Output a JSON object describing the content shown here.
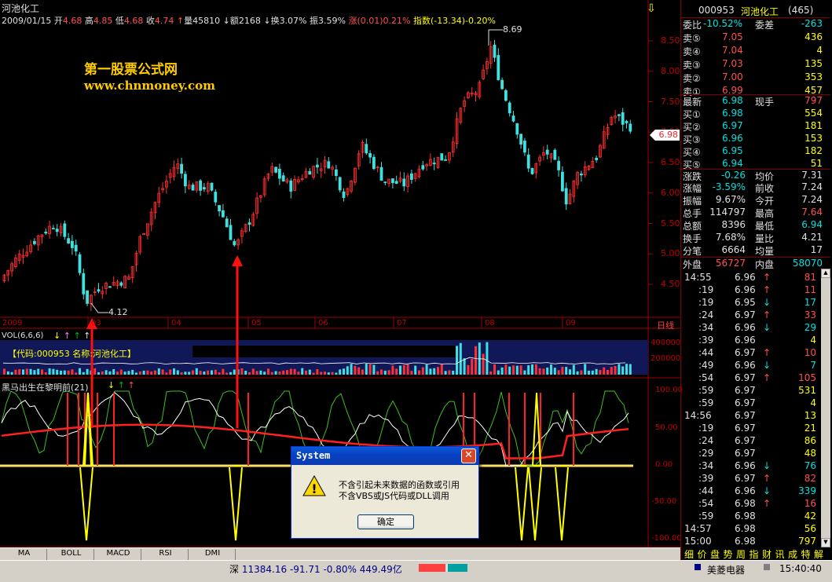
{
  "stock": {
    "name": "河池化工",
    "date": "2009/01/15",
    "open_label": "开",
    "open": "4.68",
    "high_label": "高",
    "high": "4.85",
    "low_label": "低",
    "low": "4.68",
    "close_label": "收",
    "close": "4.74",
    "vol_label": "量",
    "vol": "45810",
    "amt_label": "额",
    "amt": "2168",
    "turnover_label": "换",
    "turnover": "3.07%",
    "amp_label": "振",
    "amp": "3.59%",
    "chg_label": "涨",
    "chg": "(0.01)",
    "chg_pct": "0.21%",
    "index_label": "指数",
    "index_val": "(-13.34)",
    "index_pct": "-0.20%"
  },
  "watermark": {
    "line1": "第一股票公式网",
    "line2": "www.chnmoney.com"
  },
  "price_axis": [
    "8.50",
    "8.00",
    "7.50",
    "7.00",
    "6.50",
    "6.00",
    "5.50",
    "5.00",
    "4.50"
  ],
  "current_price_tag": "6.98",
  "annotations": {
    "high": "8.69",
    "low": "4.12"
  },
  "time_axis": {
    "year": "2009",
    "months": [
      "03",
      "04",
      "05",
      "06",
      "07",
      "08",
      "09"
    ],
    "period": "日线"
  },
  "vol_panel": {
    "title": "VOL(6,6,6)",
    "info": "【代码:000953 名称:河池化工】",
    "axis": [
      "400000",
      "200000"
    ]
  },
  "ind_panel": {
    "title": "黑马出生在黎明前(21)",
    "axis": [
      "100.00",
      "50.00",
      "0.00",
      "-50.00",
      "-100.00"
    ]
  },
  "tabs": [
    "MA",
    "BOLL",
    "MACD",
    "RSI",
    "DMI"
  ],
  "quote": {
    "header": {
      "code": "000953",
      "name": "河池化工",
      "num": "(465)"
    },
    "ratio": {
      "label1": "委比",
      "v1": "-10.52%",
      "label2": "委差",
      "v2": "-263"
    },
    "sells": [
      {
        "l": "卖⑤",
        "p": "7.05",
        "v": "436"
      },
      {
        "l": "卖④",
        "p": "7.04",
        "v": "4"
      },
      {
        "l": "卖③",
        "p": "7.03",
        "v": "135"
      },
      {
        "l": "卖②",
        "p": "7.00",
        "v": "353"
      },
      {
        "l": "卖①",
        "p": "6.99",
        "v": "457"
      }
    ],
    "latest": {
      "l": "最新",
      "p": "6.98",
      "l2": "现手",
      "v": "797"
    },
    "buys": [
      {
        "l": "买①",
        "p": "6.98",
        "v": "554"
      },
      {
        "l": "买②",
        "p": "6.97",
        "v": "181"
      },
      {
        "l": "买③",
        "p": "6.96",
        "v": "153"
      },
      {
        "l": "买④",
        "p": "6.95",
        "v": "182"
      },
      {
        "l": "买⑤",
        "p": "6.94",
        "v": "51"
      }
    ],
    "stats": [
      {
        "l1": "涨跌",
        "v1": "-0.26",
        "l2": "均价",
        "v2": "7.31"
      },
      {
        "l1": "涨幅",
        "v1": "-3.59%",
        "l2": "前收",
        "v2": "7.24"
      },
      {
        "l1": "振幅",
        "v1": "9.67%",
        "l2": "今开",
        "v2": "7.24"
      },
      {
        "l1": "总手",
        "v1": "114797",
        "l2": "最高",
        "v2": "7.64"
      },
      {
        "l1": "总额",
        "v1": "8396",
        "l2": "最低",
        "v2": "6.94"
      },
      {
        "l1": "换手",
        "v1": "7.68%",
        "l2": "量比",
        "v2": "4.21"
      },
      {
        "l1": "分笔",
        "v1": "6664",
        "l2": "均量",
        "v2": "17"
      }
    ],
    "outer": {
      "l1": "外盘",
      "v1": "56727",
      "l2": "内盘",
      "v2": "58070"
    }
  },
  "ticks": [
    {
      "t": "14:55",
      "p": "6.96",
      "v": "81",
      "d": "up"
    },
    {
      "t": ":19",
      "p": "6.96",
      "v": "11",
      "d": "up"
    },
    {
      "t": ":19",
      "p": "6.95",
      "v": "17",
      "d": "dn"
    },
    {
      "t": ":24",
      "p": "6.97",
      "v": "33",
      "d": "up"
    },
    {
      "t": ":34",
      "p": "6.96",
      "v": "29",
      "d": "dn"
    },
    {
      "t": ":39",
      "p": "6.96",
      "v": "4",
      "d": ""
    },
    {
      "t": ":44",
      "p": "6.97",
      "v": "10",
      "d": "up"
    },
    {
      "t": ":49",
      "p": "6.96",
      "v": "7",
      "d": "dn"
    },
    {
      "t": ":54",
      "p": "6.97",
      "v": "105",
      "d": "up"
    },
    {
      "t": ":59",
      "p": "6.97",
      "v": "531",
      "d": ""
    },
    {
      "t": ":59",
      "p": "6.97",
      "v": "4",
      "d": ""
    },
    {
      "t": "14:56",
      "p": "6.97",
      "v": "13",
      "d": ""
    },
    {
      "t": ":19",
      "p": "6.97",
      "v": "21",
      "d": ""
    },
    {
      "t": ":24",
      "p": "6.97",
      "v": "86",
      "d": ""
    },
    {
      "t": ":29",
      "p": "6.97",
      "v": "48",
      "d": ""
    },
    {
      "t": ":34",
      "p": "6.96",
      "v": "76",
      "d": "dn"
    },
    {
      "t": ":39",
      "p": "6.97",
      "v": "82",
      "d": "up"
    },
    {
      "t": ":44",
      "p": "6.96",
      "v": "339",
      "d": "dn"
    },
    {
      "t": ":54",
      "p": "6.98",
      "v": "16",
      "d": "up"
    },
    {
      "t": ":59",
      "p": "6.98",
      "v": "42",
      "d": ""
    },
    {
      "t": "14:57",
      "p": "6.98",
      "v": "56",
      "d": ""
    },
    {
      "t": "15:00",
      "p": "6.98",
      "v": "797",
      "d": ""
    }
  ],
  "side_tabs": [
    "细",
    "价",
    "盘",
    "势",
    "周",
    "指",
    "财",
    "讯",
    "成",
    "特",
    "解"
  ],
  "status": {
    "index_name": "深",
    "index_val": "11384.16",
    "index_chg": "-91.71",
    "index_pct": "-0.80%",
    "amount": "449.49亿",
    "ticker": "美菱电器",
    "clock": "15:40:40"
  },
  "dialog": {
    "title": "System",
    "line1": "不含引起未来数据的函数或引用",
    "line2": "不含VBS或JS代码或DLL调用",
    "ok": "确定"
  }
}
